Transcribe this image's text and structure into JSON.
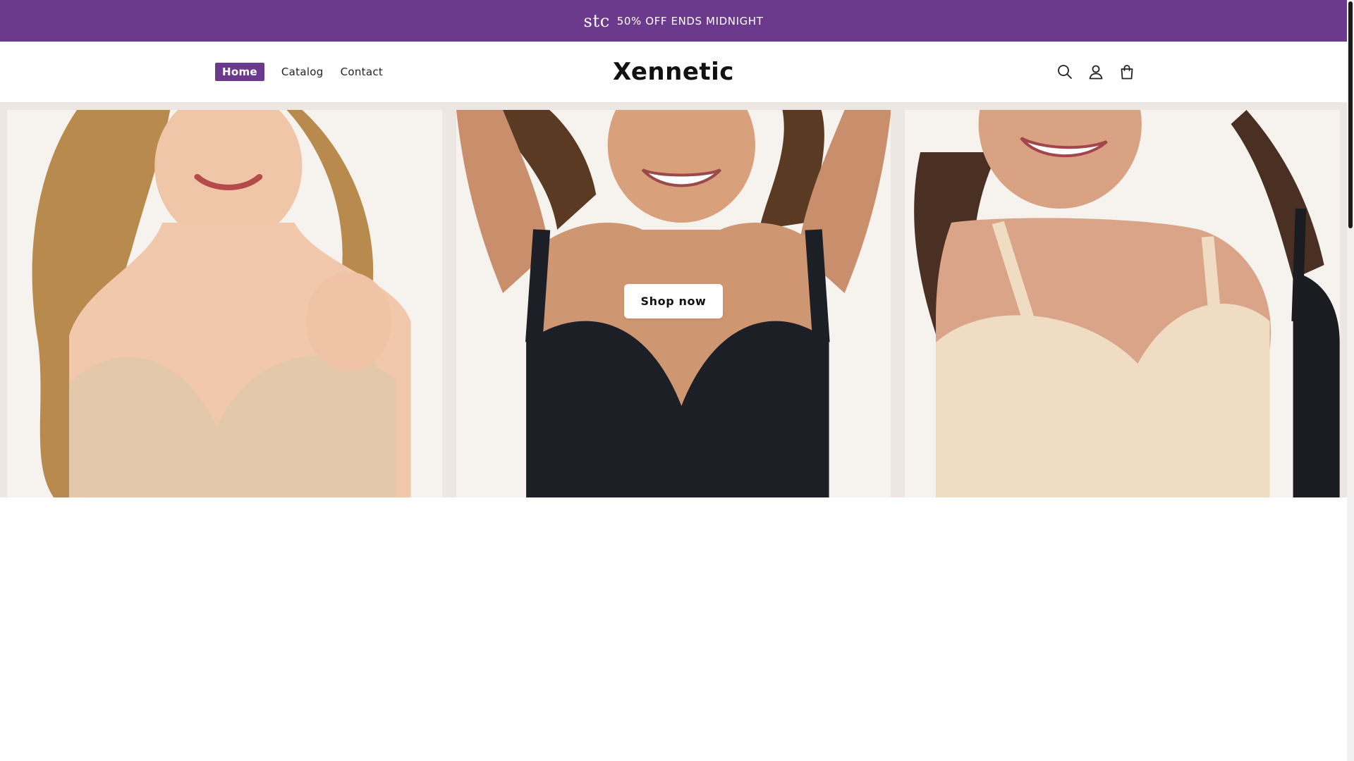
{
  "colors": {
    "accent": "#6b3a8c",
    "announcement_bg": "#6b3a8c",
    "text": "#111111"
  },
  "announcement": {
    "logo_text": "stc",
    "text": "50% OFF ENDS MIDNIGHT"
  },
  "header": {
    "nav": [
      {
        "label": "Home",
        "active": true
      },
      {
        "label": "Catalog",
        "active": false
      },
      {
        "label": "Contact",
        "active": false
      }
    ],
    "brand": "Xennetic",
    "icons": [
      "search-icon",
      "account-icon",
      "cart-icon"
    ]
  },
  "hero": {
    "panels": [
      "model-beige-plus-size",
      "model-black-bra",
      "model-beige-shapewear"
    ],
    "cta_label": "Shop now"
  }
}
